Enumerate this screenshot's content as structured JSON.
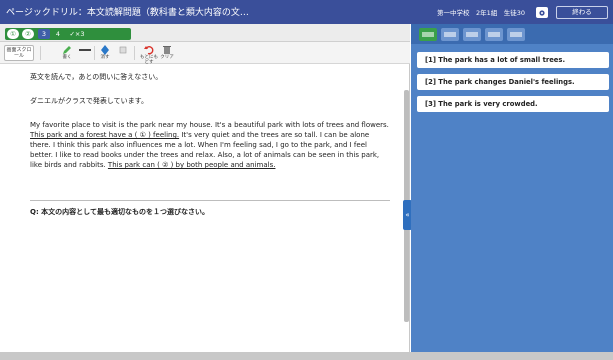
{
  "app": {
    "title": "ページックドリル：本文読解問題（教科書と類大内容の文…",
    "user_info": "第一中学校　2年1組　生徒30",
    "finish_label": "終わる"
  },
  "tabs": [
    {
      "label": "①"
    },
    {
      "label": "②"
    },
    {
      "label": "3"
    },
    {
      "label": "4"
    },
    {
      "label": "✓×3"
    }
  ],
  "toolbar": {
    "scroll_label": "画面スクロール",
    "pen_label": "書く",
    "line_label": "",
    "marker_label": "消す",
    "eraser_label": "",
    "undo_label": "もとにもどす",
    "clear_label": "クリア"
  },
  "passage": {
    "instruction": "英文を読んで，あとの問いに答えなさい。",
    "intro": "ダニエルがクラスで発表しています。",
    "s1": "My favorite place to visit is the park near my house. It's a beautiful park with lots of trees and flowers. ",
    "u1": "This park and a forest have a ( ① ) feeling.",
    "s2": " It's very quiet and the trees are so tall. I can be alone there. I think this park also influences me a lot. When I'm feeling sad, I go to the park, and I feel better. I like to read books under the trees and relax. Also, a lot of animals can be seen in this park, like birds and rabbits. ",
    "u2": "This park can ( ② ) by both people and animals."
  },
  "question": {
    "text": "Q: 本文の内容として最も適切なものを１つ選びなさい。"
  },
  "options": [
    {
      "label": "[1] The park has a lot of small trees."
    },
    {
      "label": "[2] The park changes Daniel's feelings."
    },
    {
      "label": "[3] The park is very crowded."
    }
  ],
  "colors": {
    "header_bg": "#3a4f9a",
    "right_panel_bg": "#4f82c6",
    "tab_green": "#2f8f3d",
    "active_blue": "#3f5ea8"
  },
  "icons": {
    "gear": "gear-icon",
    "collapse": "chevron-left-icon"
  }
}
